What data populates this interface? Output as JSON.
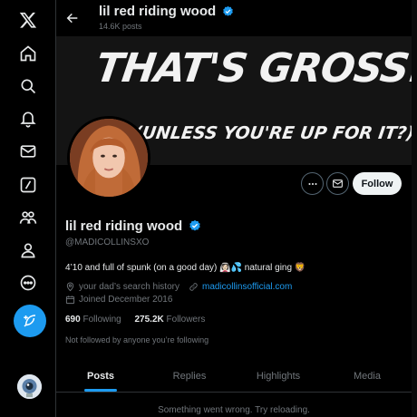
{
  "nav": {
    "items": [
      {
        "name": "x-logo-icon"
      },
      {
        "name": "home-icon"
      },
      {
        "name": "search-icon"
      },
      {
        "name": "notifications-icon"
      },
      {
        "name": "messages-icon"
      },
      {
        "name": "grok-icon"
      },
      {
        "name": "communities-icon"
      },
      {
        "name": "profile-icon"
      },
      {
        "name": "more-icon"
      }
    ],
    "post_icon": "feather-plus-icon"
  },
  "header": {
    "title": "lil red riding wood",
    "post_count": "14.6K posts"
  },
  "banner": {
    "line1": "THAT'S GROSS!",
    "line2": "(UNLESS YOU'RE UP FOR IT?)"
  },
  "profile": {
    "display_name": "lil red riding wood",
    "handle": "@MADICOLLINSXO",
    "bio": "4’10 and full of spunk (on a good day) 👰🏻‍♀️💦 natural ging 🦁",
    "location": "your dad’s search history",
    "website": "madicollinsofficial.com",
    "joined": "Joined December 2016",
    "following_count": "690",
    "following_label": "Following",
    "followers_count": "275.2K",
    "followers_label": "Followers",
    "not_followed": "Not followed by anyone you’re following",
    "follow_label": "Follow"
  },
  "tabs": [
    {
      "label": "Posts",
      "active": true
    },
    {
      "label": "Replies",
      "active": false
    },
    {
      "label": "Highlights",
      "active": false
    },
    {
      "label": "Media",
      "active": false
    }
  ],
  "feed": {
    "error": "Something went wrong. Try reloading."
  },
  "colors": {
    "accent": "#1d9bf0",
    "background": "#000000",
    "muted": "#71767b"
  }
}
